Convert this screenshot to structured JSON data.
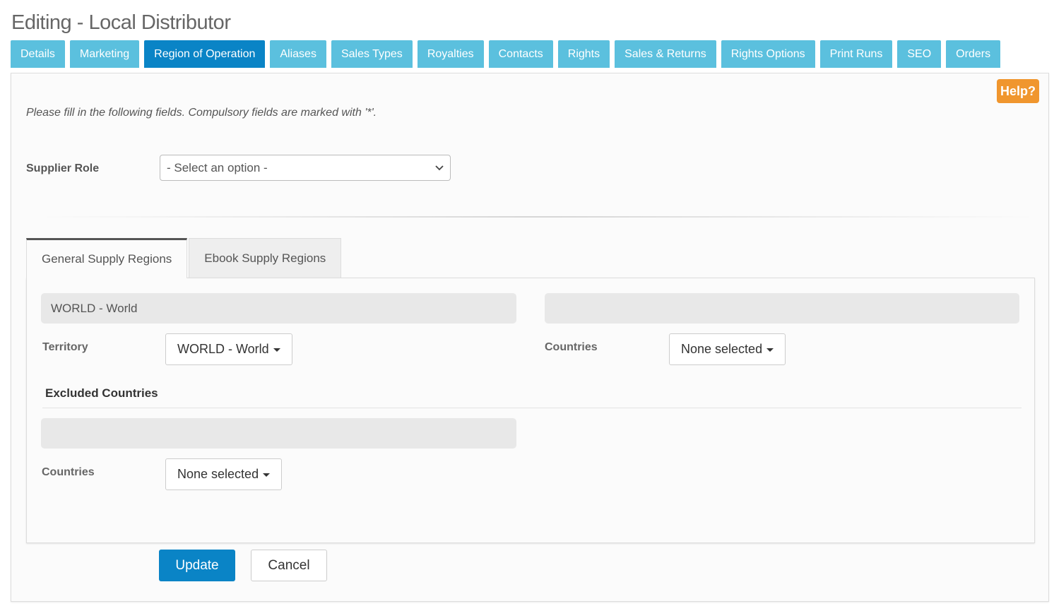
{
  "page": {
    "title": "Editing - Local Distributor"
  },
  "nav": {
    "tabs": [
      {
        "label": "Details"
      },
      {
        "label": "Marketing"
      },
      {
        "label": "Region of Operation",
        "active": true
      },
      {
        "label": "Aliases"
      },
      {
        "label": "Sales Types"
      },
      {
        "label": "Royalties"
      },
      {
        "label": "Contacts"
      },
      {
        "label": "Rights"
      },
      {
        "label": "Sales & Returns"
      },
      {
        "label": "Rights Options"
      },
      {
        "label": "Print Runs"
      },
      {
        "label": "SEO"
      },
      {
        "label": "Orders"
      }
    ]
  },
  "help": {
    "label": "Help?"
  },
  "form": {
    "instructions": "Please fill in the following fields. Compulsory fields are marked with '*'.",
    "supplier_role": {
      "label": "Supplier Role",
      "value": "- Select an option -"
    }
  },
  "regions": {
    "tabs": [
      {
        "label": "General Supply Regions",
        "active": true
      },
      {
        "label": "Ebook Supply Regions"
      }
    ],
    "territory_bar": "WORLD - World",
    "countries_bar": "",
    "territory": {
      "label": "Territory",
      "value": "WORLD - World"
    },
    "countries": {
      "label": "Countries",
      "value": "None selected"
    },
    "excluded": {
      "heading": "Excluded Countries",
      "bar": "",
      "countries": {
        "label": "Countries",
        "value": "None selected"
      }
    }
  },
  "actions": {
    "update": "Update",
    "cancel": "Cancel"
  },
  "colors": {
    "nav_tab": "#5bc0de",
    "nav_tab_active": "#0a84c6",
    "help": "#f0962e",
    "primary": "#0a84c6"
  }
}
